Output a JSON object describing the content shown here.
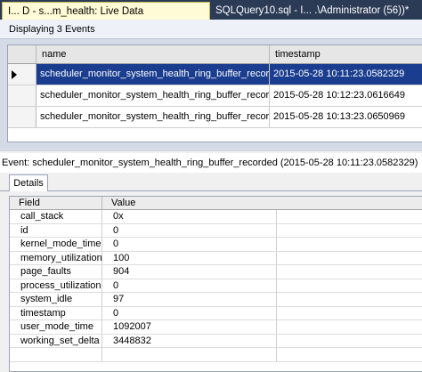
{
  "tabs": [
    {
      "label": "I... D - s...m_health: Live Data",
      "active": true
    },
    {
      "label": "SQLQuery10.sql - I... .\\Administrator (56))*",
      "active": false
    }
  ],
  "status_text": "Displaying 3 Events",
  "events_grid": {
    "columns": [
      "name",
      "timestamp"
    ],
    "rows": [
      {
        "name": "scheduler_monitor_system_health_ring_buffer_recorded",
        "timestamp": "2015-05-28 10:11:23.0582329",
        "selected": true
      },
      {
        "name": "scheduler_monitor_system_health_ring_buffer_recorded",
        "timestamp": "2015-05-28 10:12:23.0616649",
        "selected": false
      },
      {
        "name": "scheduler_monitor_system_health_ring_buffer_recorded",
        "timestamp": "2015-05-28 10:13:23.0650969",
        "selected": false
      }
    ]
  },
  "event_line": "Event: scheduler_monitor_system_health_ring_buffer_recorded (2015-05-28 10:11:23.0582329)",
  "details_tab": "Details",
  "details_grid": {
    "columns": [
      "Field",
      "Value"
    ],
    "rows": [
      {
        "field": "call_stack",
        "value": "0x"
      },
      {
        "field": "id",
        "value": "0"
      },
      {
        "field": "kernel_mode_time",
        "value": "0"
      },
      {
        "field": "memory_utilization",
        "value": "100"
      },
      {
        "field": "page_faults",
        "value": "904"
      },
      {
        "field": "process_utilization",
        "value": "0"
      },
      {
        "field": "system_idle",
        "value": "97"
      },
      {
        "field": "timestamp",
        "value": "0"
      },
      {
        "field": "user_mode_time",
        "value": "1092007"
      },
      {
        "field": "working_set_delta",
        "value": "3448832"
      }
    ]
  },
  "colors": {
    "tab_strip": "#2b3a55",
    "active_tab": "#fffbd6",
    "selection": "#1a3d8f"
  }
}
